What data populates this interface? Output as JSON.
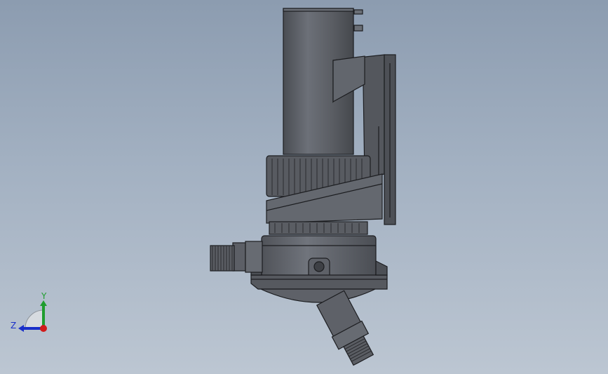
{
  "viewport": {
    "background_top": "#8c9cb0",
    "background_bottom": "#bcc6d2"
  },
  "model": {
    "body_color": "#5b5e64",
    "edge_color": "#1c1d20",
    "highlight_color": "#7a7e86"
  },
  "triad": {
    "y_label": "Y",
    "z_label": "Z",
    "y_color": "#1f9d2e",
    "z_color": "#1a2fc9",
    "x_color": "#d11a1a"
  }
}
